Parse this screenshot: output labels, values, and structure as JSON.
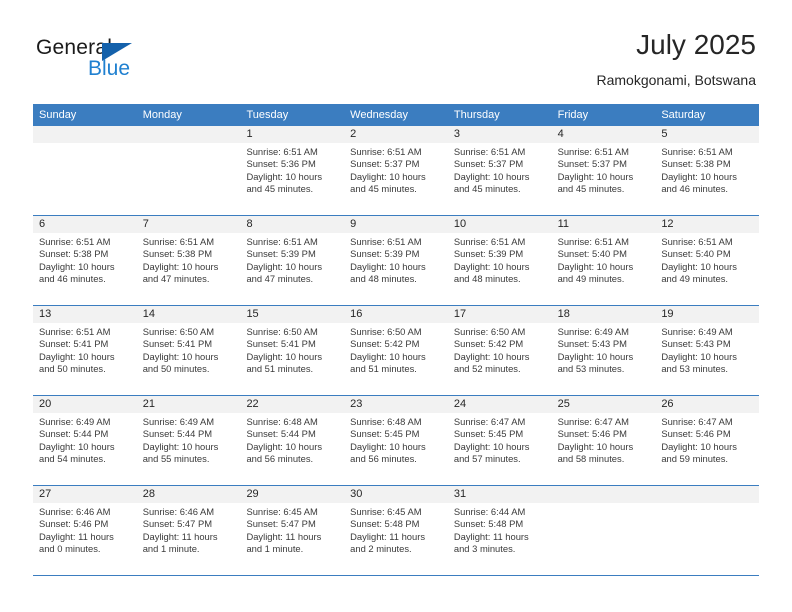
{
  "brand": {
    "name_top": "General",
    "name_bottom": "Blue",
    "accent_color": "#1461ab",
    "blue_text_color": "#2080d0"
  },
  "header": {
    "title": "July 2025",
    "subtitle": "Ramokgonami, Botswana"
  },
  "theme": {
    "header_bar_color": "#3b7dc0",
    "day_band_color": "#f2f2f2",
    "row_separator_color": "#3b7dc0",
    "text_color": "#262626"
  },
  "weekdays": [
    "Sunday",
    "Monday",
    "Tuesday",
    "Wednesday",
    "Thursday",
    "Friday",
    "Saturday"
  ],
  "weeks": [
    [
      {
        "day": "",
        "sunrise": "",
        "sunset": "",
        "daylight_1": "",
        "daylight_2": ""
      },
      {
        "day": "",
        "sunrise": "",
        "sunset": "",
        "daylight_1": "",
        "daylight_2": ""
      },
      {
        "day": "1",
        "sunrise": "Sunrise: 6:51 AM",
        "sunset": "Sunset: 5:36 PM",
        "daylight_1": "Daylight: 10 hours",
        "daylight_2": "and 45 minutes."
      },
      {
        "day": "2",
        "sunrise": "Sunrise: 6:51 AM",
        "sunset": "Sunset: 5:37 PM",
        "daylight_1": "Daylight: 10 hours",
        "daylight_2": "and 45 minutes."
      },
      {
        "day": "3",
        "sunrise": "Sunrise: 6:51 AM",
        "sunset": "Sunset: 5:37 PM",
        "daylight_1": "Daylight: 10 hours",
        "daylight_2": "and 45 minutes."
      },
      {
        "day": "4",
        "sunrise": "Sunrise: 6:51 AM",
        "sunset": "Sunset: 5:37 PM",
        "daylight_1": "Daylight: 10 hours",
        "daylight_2": "and 45 minutes."
      },
      {
        "day": "5",
        "sunrise": "Sunrise: 6:51 AM",
        "sunset": "Sunset: 5:38 PM",
        "daylight_1": "Daylight: 10 hours",
        "daylight_2": "and 46 minutes."
      }
    ],
    [
      {
        "day": "6",
        "sunrise": "Sunrise: 6:51 AM",
        "sunset": "Sunset: 5:38 PM",
        "daylight_1": "Daylight: 10 hours",
        "daylight_2": "and 46 minutes."
      },
      {
        "day": "7",
        "sunrise": "Sunrise: 6:51 AM",
        "sunset": "Sunset: 5:38 PM",
        "daylight_1": "Daylight: 10 hours",
        "daylight_2": "and 47 minutes."
      },
      {
        "day": "8",
        "sunrise": "Sunrise: 6:51 AM",
        "sunset": "Sunset: 5:39 PM",
        "daylight_1": "Daylight: 10 hours",
        "daylight_2": "and 47 minutes."
      },
      {
        "day": "9",
        "sunrise": "Sunrise: 6:51 AM",
        "sunset": "Sunset: 5:39 PM",
        "daylight_1": "Daylight: 10 hours",
        "daylight_2": "and 48 minutes."
      },
      {
        "day": "10",
        "sunrise": "Sunrise: 6:51 AM",
        "sunset": "Sunset: 5:39 PM",
        "daylight_1": "Daylight: 10 hours",
        "daylight_2": "and 48 minutes."
      },
      {
        "day": "11",
        "sunrise": "Sunrise: 6:51 AM",
        "sunset": "Sunset: 5:40 PM",
        "daylight_1": "Daylight: 10 hours",
        "daylight_2": "and 49 minutes."
      },
      {
        "day": "12",
        "sunrise": "Sunrise: 6:51 AM",
        "sunset": "Sunset: 5:40 PM",
        "daylight_1": "Daylight: 10 hours",
        "daylight_2": "and 49 minutes."
      }
    ],
    [
      {
        "day": "13",
        "sunrise": "Sunrise: 6:51 AM",
        "sunset": "Sunset: 5:41 PM",
        "daylight_1": "Daylight: 10 hours",
        "daylight_2": "and 50 minutes."
      },
      {
        "day": "14",
        "sunrise": "Sunrise: 6:50 AM",
        "sunset": "Sunset: 5:41 PM",
        "daylight_1": "Daylight: 10 hours",
        "daylight_2": "and 50 minutes."
      },
      {
        "day": "15",
        "sunrise": "Sunrise: 6:50 AM",
        "sunset": "Sunset: 5:41 PM",
        "daylight_1": "Daylight: 10 hours",
        "daylight_2": "and 51 minutes."
      },
      {
        "day": "16",
        "sunrise": "Sunrise: 6:50 AM",
        "sunset": "Sunset: 5:42 PM",
        "daylight_1": "Daylight: 10 hours",
        "daylight_2": "and 51 minutes."
      },
      {
        "day": "17",
        "sunrise": "Sunrise: 6:50 AM",
        "sunset": "Sunset: 5:42 PM",
        "daylight_1": "Daylight: 10 hours",
        "daylight_2": "and 52 minutes."
      },
      {
        "day": "18",
        "sunrise": "Sunrise: 6:49 AM",
        "sunset": "Sunset: 5:43 PM",
        "daylight_1": "Daylight: 10 hours",
        "daylight_2": "and 53 minutes."
      },
      {
        "day": "19",
        "sunrise": "Sunrise: 6:49 AM",
        "sunset": "Sunset: 5:43 PM",
        "daylight_1": "Daylight: 10 hours",
        "daylight_2": "and 53 minutes."
      }
    ],
    [
      {
        "day": "20",
        "sunrise": "Sunrise: 6:49 AM",
        "sunset": "Sunset: 5:44 PM",
        "daylight_1": "Daylight: 10 hours",
        "daylight_2": "and 54 minutes."
      },
      {
        "day": "21",
        "sunrise": "Sunrise: 6:49 AM",
        "sunset": "Sunset: 5:44 PM",
        "daylight_1": "Daylight: 10 hours",
        "daylight_2": "and 55 minutes."
      },
      {
        "day": "22",
        "sunrise": "Sunrise: 6:48 AM",
        "sunset": "Sunset: 5:44 PM",
        "daylight_1": "Daylight: 10 hours",
        "daylight_2": "and 56 minutes."
      },
      {
        "day": "23",
        "sunrise": "Sunrise: 6:48 AM",
        "sunset": "Sunset: 5:45 PM",
        "daylight_1": "Daylight: 10 hours",
        "daylight_2": "and 56 minutes."
      },
      {
        "day": "24",
        "sunrise": "Sunrise: 6:47 AM",
        "sunset": "Sunset: 5:45 PM",
        "daylight_1": "Daylight: 10 hours",
        "daylight_2": "and 57 minutes."
      },
      {
        "day": "25",
        "sunrise": "Sunrise: 6:47 AM",
        "sunset": "Sunset: 5:46 PM",
        "daylight_1": "Daylight: 10 hours",
        "daylight_2": "and 58 minutes."
      },
      {
        "day": "26",
        "sunrise": "Sunrise: 6:47 AM",
        "sunset": "Sunset: 5:46 PM",
        "daylight_1": "Daylight: 10 hours",
        "daylight_2": "and 59 minutes."
      }
    ],
    [
      {
        "day": "27",
        "sunrise": "Sunrise: 6:46 AM",
        "sunset": "Sunset: 5:46 PM",
        "daylight_1": "Daylight: 11 hours",
        "daylight_2": "and 0 minutes."
      },
      {
        "day": "28",
        "sunrise": "Sunrise: 6:46 AM",
        "sunset": "Sunset: 5:47 PM",
        "daylight_1": "Daylight: 11 hours",
        "daylight_2": "and 1 minute."
      },
      {
        "day": "29",
        "sunrise": "Sunrise: 6:45 AM",
        "sunset": "Sunset: 5:47 PM",
        "daylight_1": "Daylight: 11 hours",
        "daylight_2": "and 1 minute."
      },
      {
        "day": "30",
        "sunrise": "Sunrise: 6:45 AM",
        "sunset": "Sunset: 5:48 PM",
        "daylight_1": "Daylight: 11 hours",
        "daylight_2": "and 2 minutes."
      },
      {
        "day": "31",
        "sunrise": "Sunrise: 6:44 AM",
        "sunset": "Sunset: 5:48 PM",
        "daylight_1": "Daylight: 11 hours",
        "daylight_2": "and 3 minutes."
      },
      {
        "day": "",
        "sunrise": "",
        "sunset": "",
        "daylight_1": "",
        "daylight_2": ""
      },
      {
        "day": "",
        "sunrise": "",
        "sunset": "",
        "daylight_1": "",
        "daylight_2": ""
      }
    ]
  ]
}
